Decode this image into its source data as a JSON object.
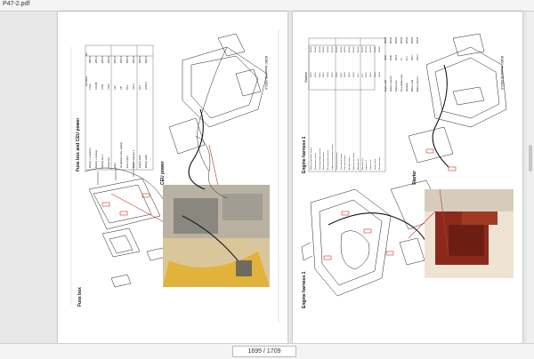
{
  "window": {
    "title": "P47-2.pdf"
  },
  "viewer": {
    "page_indicator": "1695 / 1709"
  },
  "left_page": {
    "footer_code": "KDEC Issued 06.2015 A",
    "section_title": "Fuse box and CEU power",
    "labels": {
      "fuse_box": "Fuse box",
      "ceu_power": "CEU power"
    },
    "table": {
      "headers": [
        "No",
        "Harness"
      ],
      "rows": [
        [
          "Battery + connector",
          "CN12",
          "W/1F4"
        ],
        [
          "Battery + harness",
          "CN14B",
          "W/1F4"
        ],
        [
          "Battery box 2",
          "CN11",
          "W/1F4"
        ],
        [
          "Power box",
          "CN01",
          "W/1F4"
        ],
        [
          "CEU",
          "X12",
          "W/1F4"
        ],
        [
          "LR (battery relay, engine)",
          "CB",
          "W/1F4"
        ],
        [
          "Fuse 2 (K2)",
          "X0-1",
          "W/1F4"
        ],
        [
          "Engine harness 1",
          "X12-2",
          "W/1F4"
        ],
        [
          "Engine earth",
          "X0-1",
          "W/1F4"
        ],
        [
          "Battery earth",
          "GND1-1",
          "W/1F4"
        ]
      ]
    }
  },
  "right_page": {
    "footer_code": "KDEC Issued 06.2015 A",
    "section_title": "Engine harness 1",
    "starter_title": "Starter",
    "labels": {
      "engine_harness_1": "Engine harness 1",
      "starter": "Starter"
    },
    "starter_table": {
      "rows": [
        [
          "Engine earth",
          "CN60",
          "W/5G5"
        ],
        [
          "Starter connector",
          "CN40",
          "W/5G5"
        ],
        [
          "Starter relay",
          "CN14",
          "W/5G5"
        ],
        [
          "Fuse (starter relay)",
          "X1",
          "W/5G5"
        ],
        [
          "Alternator",
          "X0-1",
          "W/5G5"
        ],
        [
          "Battery earth",
          "CN0-1",
          "W/5G5"
        ],
        [
          "Battery relay box",
          "CN0-3",
          "W/5G5"
        ]
      ]
    },
    "table": {
      "rows": [
        [
          "Water temperature sensor",
          "CN50",
          "W/5G5"
        ],
        [
          "Oil pressure sensor",
          "CN51",
          "W/5G5"
        ],
        [
          "Fuel temperature sensor",
          "CN52",
          "W/5G5"
        ],
        [
          "Rail pressure sensor",
          "CN53",
          "W/5G5"
        ],
        [
          "Boost pressure sensor",
          "CN54",
          "W/5G5"
        ],
        [
          "Intake air temperature sensor",
          "CN55",
          "W/5G5"
        ],
        [
          "Crank speed sensor",
          "CN56",
          "W/5G5"
        ],
        [
          "Cam speed sensor",
          "CN57",
          "W/5G5"
        ],
        [
          "Fuel level sensor",
          "CN58",
          "W/5G5"
        ],
        [
          "Air filter sensor",
          "CN59",
          "W/5G5"
        ],
        [
          "Water in fuel sensor",
          "CN60",
          "W/5G5"
        ],
        [
          "Alternator B+",
          "X0-1",
          "W/5G5"
        ],
        [
          "Alternator D+",
          "X0-2",
          "W/5G5"
        ],
        [
          "Injector 1-2",
          "CN61",
          "W/5G5"
        ],
        [
          "Injector 3-4",
          "CN62",
          "W/5G5"
        ],
        [
          "Starter relay",
          "CN63",
          "W/5G5"
        ],
        [
          "Pre-heat relay",
          "CN64",
          "W/5G5"
        ]
      ]
    }
  }
}
